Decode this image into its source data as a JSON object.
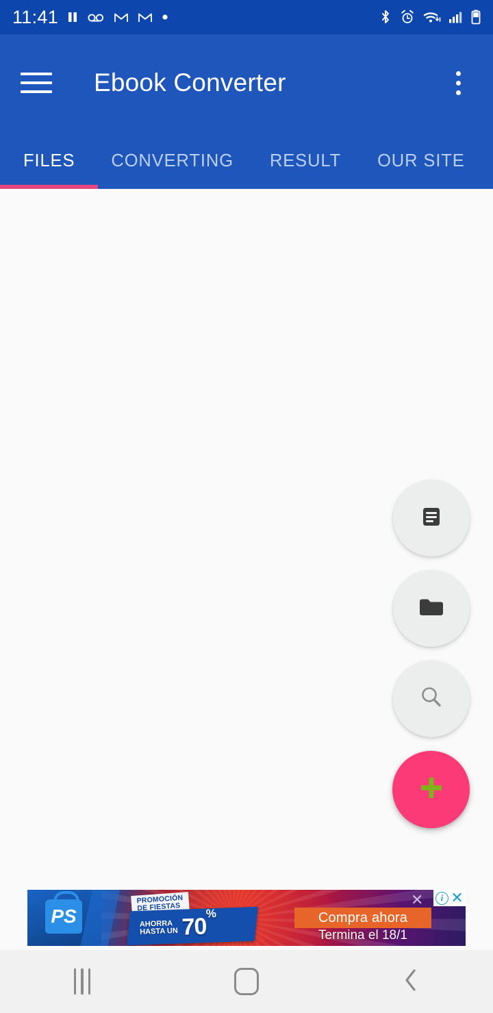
{
  "status_bar": {
    "time": "11:41",
    "left_icons": [
      {
        "name": "pause-icon",
        "glyph": "❚❚"
      },
      {
        "name": "voicemail-icon",
        "glyph": "oo"
      },
      {
        "name": "gmail-icon-1",
        "glyph": "M"
      },
      {
        "name": "gmail-icon-2",
        "glyph": "M"
      },
      {
        "name": "notification-dot-icon",
        "glyph": "•"
      }
    ],
    "right_icons": [
      {
        "name": "bluetooth-icon"
      },
      {
        "name": "alarm-icon"
      },
      {
        "name": "wifi-icon"
      },
      {
        "name": "cellular-signal-icon"
      },
      {
        "name": "battery-icon"
      }
    ],
    "background_color": "#0d47ad"
  },
  "app_bar": {
    "title": "Ebook Converter",
    "menu_label": "Menu",
    "overflow_label": "More options",
    "background_color": "#1f56bb"
  },
  "tabs": {
    "items": [
      {
        "label": "FILES",
        "active": true
      },
      {
        "label": "CONVERTING",
        "active": false
      },
      {
        "label": "RESULT",
        "active": false
      },
      {
        "label": "OUR SITE",
        "active": false
      }
    ],
    "indicator_color": "#e8467e",
    "active_text_color": "#ffffff",
    "inactive_text_color": "#bcd0ee"
  },
  "content": {
    "empty_state_text": "",
    "background_color": "#fafafa"
  },
  "fabs": [
    {
      "name": "document-fab",
      "icon": "document-lines-icon",
      "label": "Add document",
      "background": "#eceded"
    },
    {
      "name": "folder-fab",
      "icon": "folder-icon",
      "label": "Browse folder",
      "background": "#eceded"
    },
    {
      "name": "search-fab",
      "icon": "magnifier-icon",
      "label": "Search files",
      "background": "#eceded"
    },
    {
      "name": "add-fab",
      "icon": "plus-icon",
      "label": "Add",
      "background": "#fc3a77",
      "icon_color": "#7cb518"
    }
  ],
  "ad": {
    "promo_line1": "PROMOCIÓN",
    "promo_line2": "DE FIESTAS",
    "save_line1": "AHORRA",
    "save_line2": "HASTA UN",
    "discount": "70",
    "discount_symbol": "%",
    "cta": "Compra ahora",
    "ends": "Termina el 18/1",
    "brand_glyph": "PS",
    "info_glyph": "i",
    "close_glyph": "✕",
    "deco_glyph": "✕"
  },
  "nav_bar": {
    "recents_label": "Recents",
    "home_label": "Home",
    "back_label": "Back",
    "back_glyph": "❮",
    "background_color": "#f1f1f1"
  }
}
